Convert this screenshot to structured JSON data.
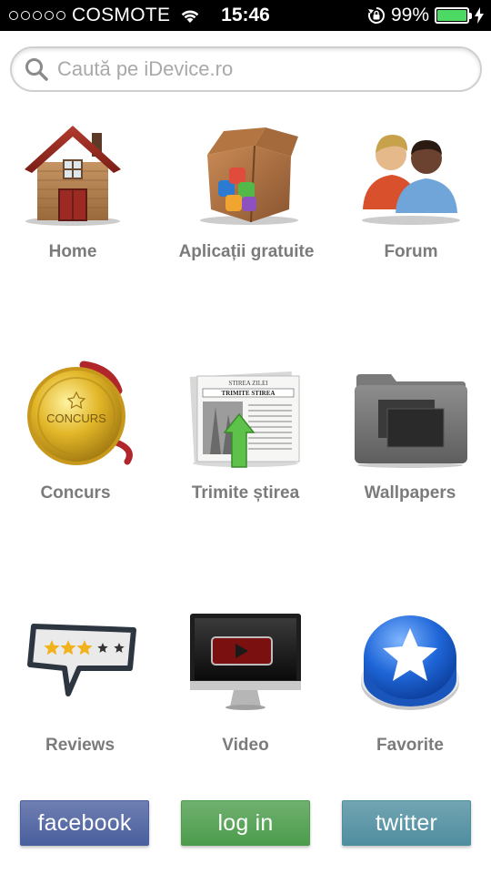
{
  "status_bar": {
    "carrier": "COSMOTE",
    "time": "15:46",
    "battery": "99%",
    "battery_level": 0.99,
    "icons": [
      "signal-dots-icon",
      "wifi-icon",
      "rotation-lock-icon",
      "battery-icon",
      "charging-bolt-icon"
    ]
  },
  "search": {
    "placeholder": "Caută pe iDevice.ro",
    "value": ""
  },
  "menu": [
    {
      "label": "Home",
      "icon": "house-icon"
    },
    {
      "label": "Aplicații gratuite",
      "icon": "app-box-icon"
    },
    {
      "label": "Forum",
      "icon": "people-icon"
    },
    {
      "label": "Concurs",
      "icon": "medal-icon",
      "icon_text": "CONCURS"
    },
    {
      "label": "Trimite știrea",
      "icon": "newspaper-upload-icon",
      "icon_text": "STIREA ZILEI",
      "icon_text2": "TRIMITE STIREA"
    },
    {
      "label": "Wallpapers",
      "icon": "folder-icon"
    },
    {
      "label": "Reviews",
      "icon": "rating-bubble-icon",
      "rating": 3,
      "rating_max": 5
    },
    {
      "label": "Video",
      "icon": "monitor-video-icon"
    },
    {
      "label": "Favorite",
      "icon": "star-button-icon"
    }
  ],
  "bottom_buttons": [
    {
      "label": "facebook",
      "color": "#4a5f9e"
    },
    {
      "label": "log in",
      "color": "#4c9c4c"
    },
    {
      "label": "twitter",
      "color": "#4f8e9f"
    }
  ],
  "colors": {
    "label_gray": "#7b7b7b",
    "battery_green": "#4cd964"
  }
}
